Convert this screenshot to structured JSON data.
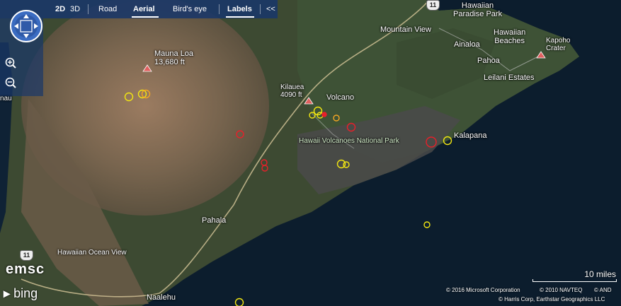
{
  "toolbar": {
    "items": [
      "2D",
      "3D",
      "Road",
      "Aerial",
      "Bird's eye",
      "Labels"
    ],
    "collapse": "<<"
  },
  "map": {
    "places": [
      {
        "name": "Mauna Loa",
        "sub": "13,680 ft"
      },
      {
        "name": "Kilauea",
        "sub": "4090 ft"
      },
      {
        "name": "Volcano"
      },
      {
        "name": "Mountain View"
      },
      {
        "name": "Hawaiian Paradise Park",
        "line1": "Hawaiian",
        "line2": "Paradise Park"
      },
      {
        "name": "Ainaloa"
      },
      {
        "name": "Hawaiian Beaches",
        "line1": "Hawaiian",
        "line2": "Beaches"
      },
      {
        "name": "Pahoa"
      },
      {
        "name": "Leilani Estates"
      },
      {
        "name": "Kapoho Crater",
        "line1": "Kapoho",
        "line2": "Crater"
      },
      {
        "name": "Kalapana"
      },
      {
        "name": "Hawaii Volcanoes National Park"
      },
      {
        "name": "Pahala"
      },
      {
        "name": "Hawaiian Ocean View"
      },
      {
        "name": "Naalehu"
      },
      {
        "name": "nau"
      }
    ],
    "highway_shields": [
      "11",
      "11"
    ]
  },
  "quake_colors": {
    "yellow": "#f2e612",
    "orange": "#f5a623",
    "red": "#e8202a"
  },
  "scale": {
    "label": "10 miles"
  },
  "credits": {
    "line1a": "© 2016 Microsoft Corporation",
    "line1b": "© 2010 NAVTEQ",
    "line1c": "© AND",
    "line2": "© Harris Corp, Earthstar Geographics LLC"
  },
  "brand": {
    "emsc": "emsc",
    "bing": "bing"
  },
  "icons": [
    "pan-dial-icon",
    "zoom-in-icon",
    "zoom-out-icon",
    "volcano-triangle-icon",
    "bing-logo-icon"
  ]
}
